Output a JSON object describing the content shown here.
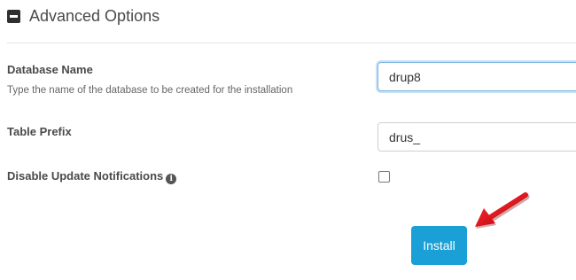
{
  "section": {
    "title": "Advanced Options",
    "collapse_icon": "minus-square-icon"
  },
  "fields": {
    "database_name": {
      "label": "Database Name",
      "help": "Type the name of the database to be created for the installation",
      "value": "drup8"
    },
    "table_prefix": {
      "label": "Table Prefix",
      "value": "drus_"
    },
    "disable_updates": {
      "label": "Disable Update Notifications",
      "info_icon": "info-circle-icon",
      "checked": false
    }
  },
  "actions": {
    "install_label": "Install",
    "install_color": "#1a9fd6"
  },
  "annotation": {
    "arrow_color": "#e0141b",
    "arrow_icon": "red-arrow-icon"
  }
}
